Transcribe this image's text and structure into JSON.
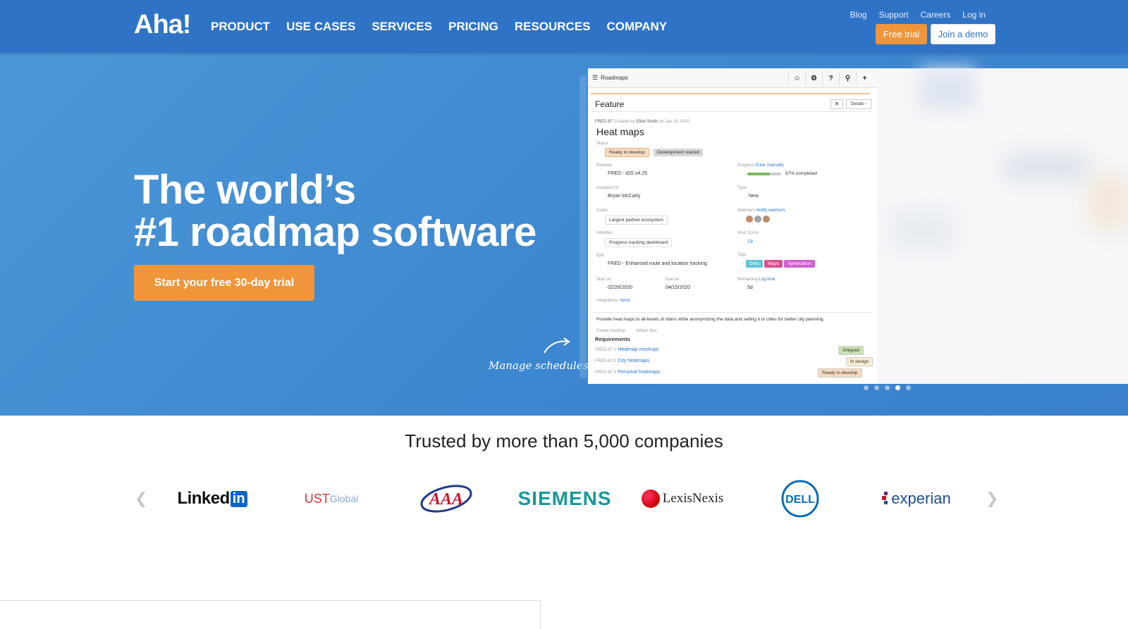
{
  "header": {
    "logo": "Aha!",
    "nav": [
      "PRODUCT",
      "USE CASES",
      "SERVICES",
      "PRICING",
      "RESOURCES",
      "COMPANY"
    ],
    "util": [
      "Blog",
      "Support",
      "Careers",
      "Log in"
    ],
    "free_trial": "Free trial",
    "join_demo": "Join a demo"
  },
  "hero": {
    "title_line1": "The world’s",
    "title_line2": "#1 roadmap software",
    "cta": "Start your free 30-day trial",
    "callout": "Manage schedules",
    "carousel_active_index": 3,
    "carousel_count": 5
  },
  "mock": {
    "app_title": "Roadmaps",
    "panel_title": "Feature",
    "details": "Details",
    "id": "FRED-87",
    "created_by": "Created by",
    "creator": "Elliot Smith",
    "created_on": "on Jan 10, 2020",
    "feature_name": "Heat maps",
    "status_label": "Status",
    "status_value": "Ready to develop",
    "status_tag": "Development started",
    "release_label": "Release",
    "release_value": "FRED - iOS v4.25",
    "progress_label": "Progress",
    "progress_mode": "Enter manually",
    "progress_percent": 67,
    "progress_text": "67% completed",
    "assigned_label": "Assigned to",
    "assigned_value": "Bryan McCarty",
    "type_label": "Type",
    "type_value": "New",
    "goals_label": "Goals",
    "goals_value": "Largest partner ecosystem",
    "watchers_label": "Watchers",
    "watchers_action": "Notify watchers",
    "initiative_label": "Initiative",
    "initiative_value": "Progress tracking dashboard",
    "score_label": "Aha! Score",
    "score_value": "19",
    "epic_label": "Epic",
    "epic_value": "FRED - Enhanced route and location tracking",
    "tags_label": "Tags",
    "tags": [
      "Data",
      "Maps",
      "Syndication"
    ],
    "start_label": "Start on",
    "start_value": "02/26/2020",
    "due_label": "Due on",
    "due_value": "04/15/2020",
    "remaining_label": "Remaining",
    "remaining_value": "5d",
    "log_time": "Log time",
    "integrations_label": "Integrations",
    "integrations_action": "Send",
    "description": "Provide heat maps to all-levels of riders while anonymizing the data and selling it to cities for better city planning.",
    "create_mockup": "Create mockup",
    "attach_files": "Attach files",
    "requirements_label": "Requirements",
    "requirements": [
      {
        "id": "FRED-87-1",
        "name": "Heatmap mockups",
        "status": "Shipped"
      },
      {
        "id": "FRED-87-2",
        "name": "City heatmaps",
        "status": "In design"
      },
      {
        "id": "FRED-87-3",
        "name": "Personal heatmaps",
        "status": "Ready to develop"
      }
    ]
  },
  "trusted": {
    "heading": "Trusted by more than 5,000 companies",
    "logos": [
      "LinkedIn",
      "UST Global",
      "AAA",
      "SIEMENS",
      "LexisNexis",
      "DELL",
      "experian"
    ]
  },
  "colors": {
    "header_bg": "#2f73c6",
    "hero_bg": "#3d87d0",
    "accent_orange": "#f0953a"
  }
}
